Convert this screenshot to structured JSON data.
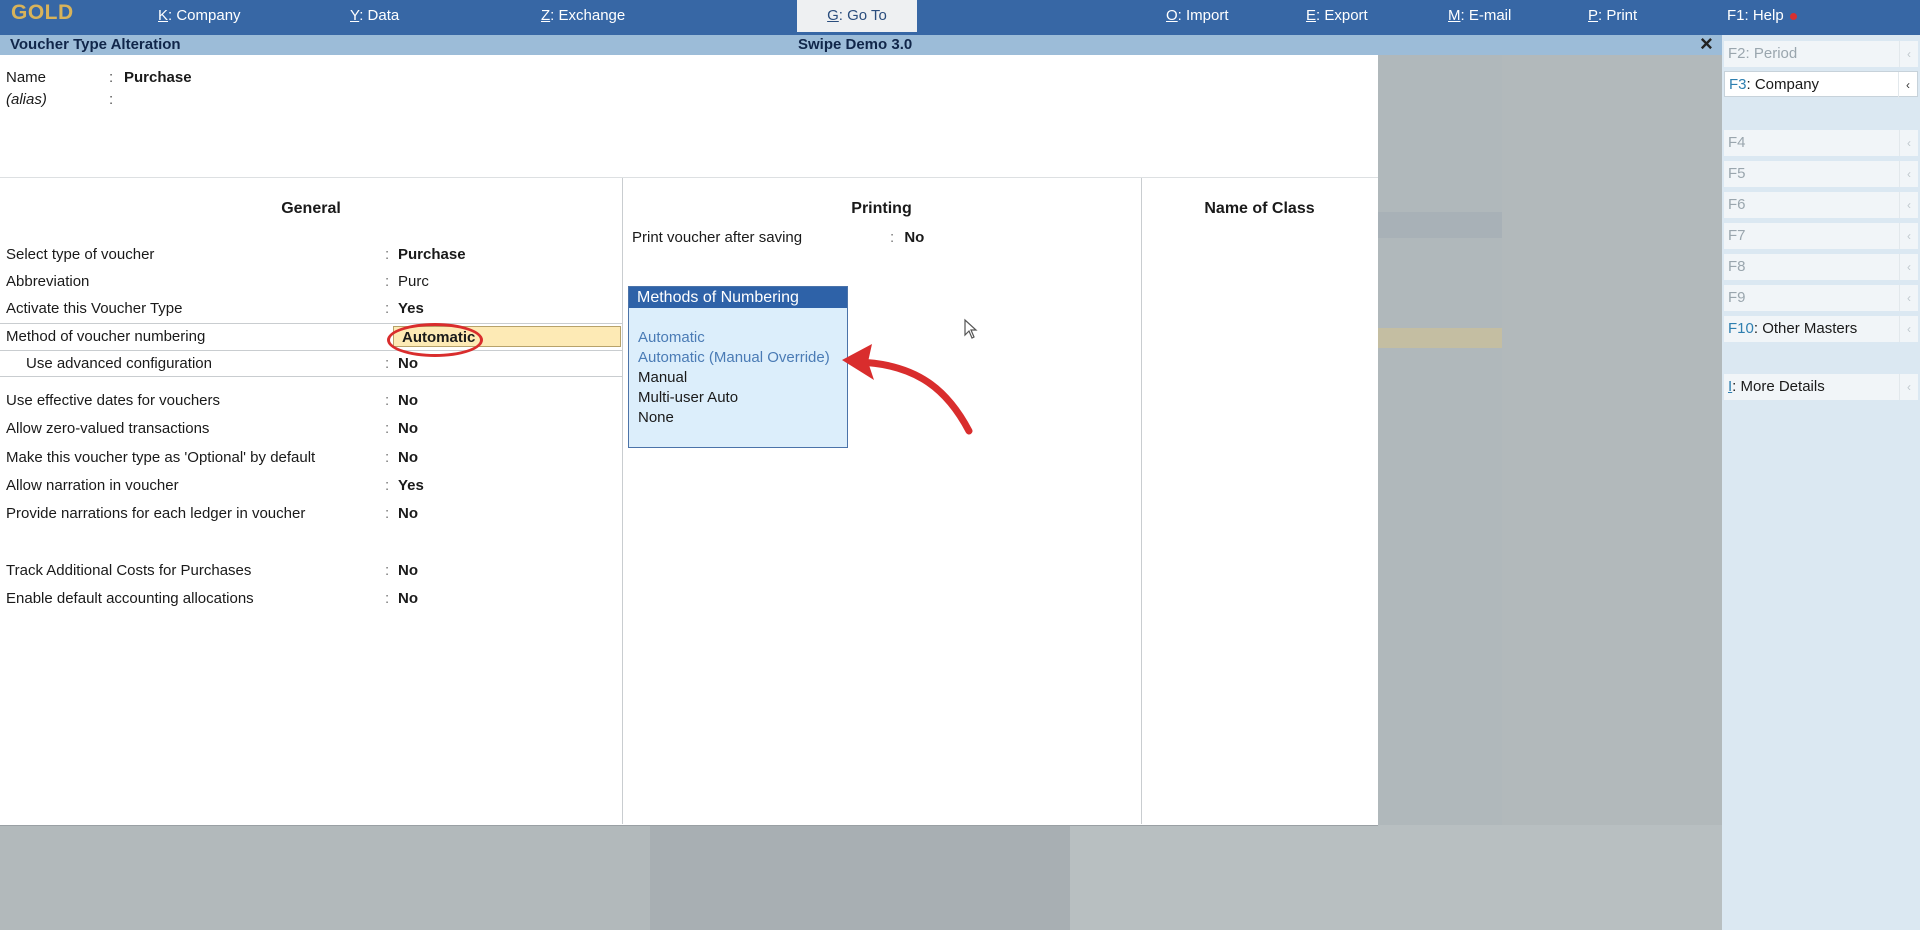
{
  "topbar": {
    "brand": "GOLD",
    "items": [
      {
        "key": "K",
        "label": ": Company"
      },
      {
        "key": "Y",
        "label": ": Data"
      },
      {
        "key": "Z",
        "label": ": Exchange"
      },
      {
        "key": "G",
        "label": ": Go To"
      },
      {
        "key": "O",
        "label": ": Import"
      },
      {
        "key": "E",
        "label": ": Export"
      },
      {
        "key": "M",
        "label": ": E-mail"
      },
      {
        "key": "P",
        "label": ": Print"
      },
      {
        "key": "F1",
        "label": ": Help"
      }
    ]
  },
  "window": {
    "title": "Voucher Type Alteration",
    "company": "Swipe Demo 3.0",
    "close_symbol": "×"
  },
  "header_fields": {
    "name_label": "Name",
    "name_value": "Purchase",
    "alias_label": "(alias)",
    "colon": ":"
  },
  "columns": {
    "general": "General",
    "printing": "Printing",
    "name_of_class": "Name of Class"
  },
  "general_fields": [
    {
      "label": "Select type of voucher",
      "value": "Purchase"
    },
    {
      "label": "Abbreviation",
      "value": "Purc"
    },
    {
      "label": "Activate this Voucher Type",
      "value": "Yes"
    },
    {
      "label": "Method of voucher numbering",
      "value": "Automatic"
    },
    {
      "label": "Use advanced configuration",
      "value": "No"
    },
    {
      "label": "Use effective dates for vouchers",
      "value": "No"
    },
    {
      "label": "Allow zero-valued transactions",
      "value": "No"
    },
    {
      "label": "Make this voucher type as 'Optional' by default",
      "value": "No"
    },
    {
      "label": "Allow narration in voucher",
      "value": "Yes"
    },
    {
      "label": "Provide narrations for each ledger in voucher",
      "value": "No"
    },
    {
      "label": "Track Additional Costs for Purchases",
      "value": "No"
    },
    {
      "label": "Enable default accounting allocations",
      "value": "No"
    }
  ],
  "printing": {
    "label": "Print voucher after saving",
    "value": "No"
  },
  "numbering_popup": {
    "title": "Methods of Numbering",
    "options": [
      "Automatic",
      "Automatic (Manual Override)",
      "Manual",
      "Multi-user Auto",
      "None"
    ]
  },
  "sidebar": {
    "items": [
      {
        "key": "F2",
        "label": ": Period"
      },
      {
        "key": "F3",
        "label": ": Company"
      },
      {
        "key": "F4",
        "label": ""
      },
      {
        "key": "F5",
        "label": ""
      },
      {
        "key": "F6",
        "label": ""
      },
      {
        "key": "F7",
        "label": ""
      },
      {
        "key": "F8",
        "label": ""
      },
      {
        "key": "F9",
        "label": ""
      },
      {
        "key": "F10",
        "label": ": Other Masters"
      },
      {
        "key": "I",
        "label": ": More Details"
      }
    ],
    "chevron": "‹"
  },
  "colors": {
    "topbar": "#3767a5",
    "titlebar": "#9cbcd8",
    "popup_header": "#2e62a8",
    "highlight_input": "#fdeab5",
    "annotation_red": "#d92d2d"
  }
}
